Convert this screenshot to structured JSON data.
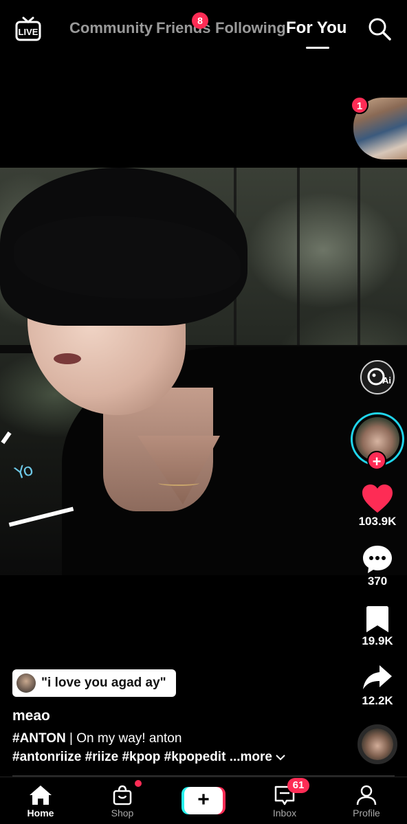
{
  "top_nav": {
    "live_label": "LIVE",
    "tabs": [
      {
        "label": "Community"
      },
      {
        "label": "Friends",
        "badge": "8"
      },
      {
        "label": "Following"
      },
      {
        "label": "For You",
        "active": true
      }
    ]
  },
  "story": {
    "badge": "1"
  },
  "video": {
    "sticker_text": "Yo"
  },
  "right_rail": {
    "ai_label": "Ai",
    "follow_symbol": "+",
    "likes": "103.9K",
    "comments": "370",
    "saves": "19.9K",
    "shares": "12.2K"
  },
  "post": {
    "lyric": "\"i love you agad ay\"",
    "username": "meao",
    "caption_tag": "#ANTON",
    "caption_text": " | On my way! anton",
    "hashtags": "#antonriize #riize #kpop #kpopedit",
    "more_label": "...more"
  },
  "bottom_nav": {
    "home": "Home",
    "shop": "Shop",
    "create": "+",
    "inbox": "Inbox",
    "inbox_badge": "61",
    "profile": "Profile"
  },
  "colors": {
    "accent_red": "#fe2c55",
    "accent_cyan": "#25f4ee",
    "creator_ring": "#20d5ec"
  }
}
